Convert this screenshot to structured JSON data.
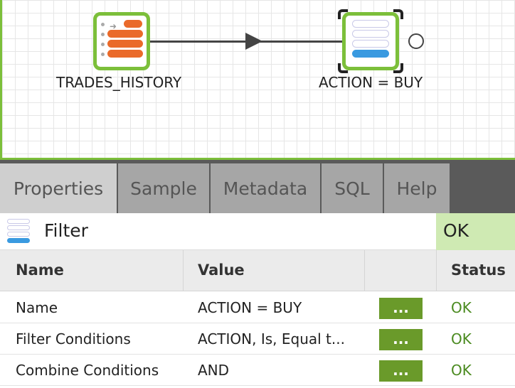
{
  "canvas": {
    "nodes": [
      {
        "label": "TRADES_HISTORY"
      },
      {
        "label": "ACTION = BUY"
      }
    ]
  },
  "tabs": [
    {
      "label": "Properties",
      "active": true
    },
    {
      "label": "Sample",
      "active": false
    },
    {
      "label": "Metadata",
      "active": false
    },
    {
      "label": "SQL",
      "active": false
    },
    {
      "label": "Help",
      "active": false
    }
  ],
  "panel": {
    "title": "Filter",
    "status": "OK"
  },
  "table": {
    "headers": {
      "name": "Name",
      "value": "Value",
      "status": "Status"
    },
    "rows": [
      {
        "name": "Name",
        "value": "ACTION = BUY",
        "button": "...",
        "status": "OK"
      },
      {
        "name": "Filter Conditions",
        "value": "ACTION, Is, Equal t...",
        "button": "...",
        "status": "OK"
      },
      {
        "name": "Combine Conditions",
        "value": "AND",
        "button": "...",
        "status": "OK"
      }
    ]
  },
  "colors": {
    "accent_green": "#7cbf3a",
    "button_green": "#6a9a2a",
    "status_ok_bg": "#cfeab3",
    "status_ok_text": "#4a8a1f",
    "source_bar": "#ea6a2a",
    "filter_bar": "#3a9ae0"
  }
}
